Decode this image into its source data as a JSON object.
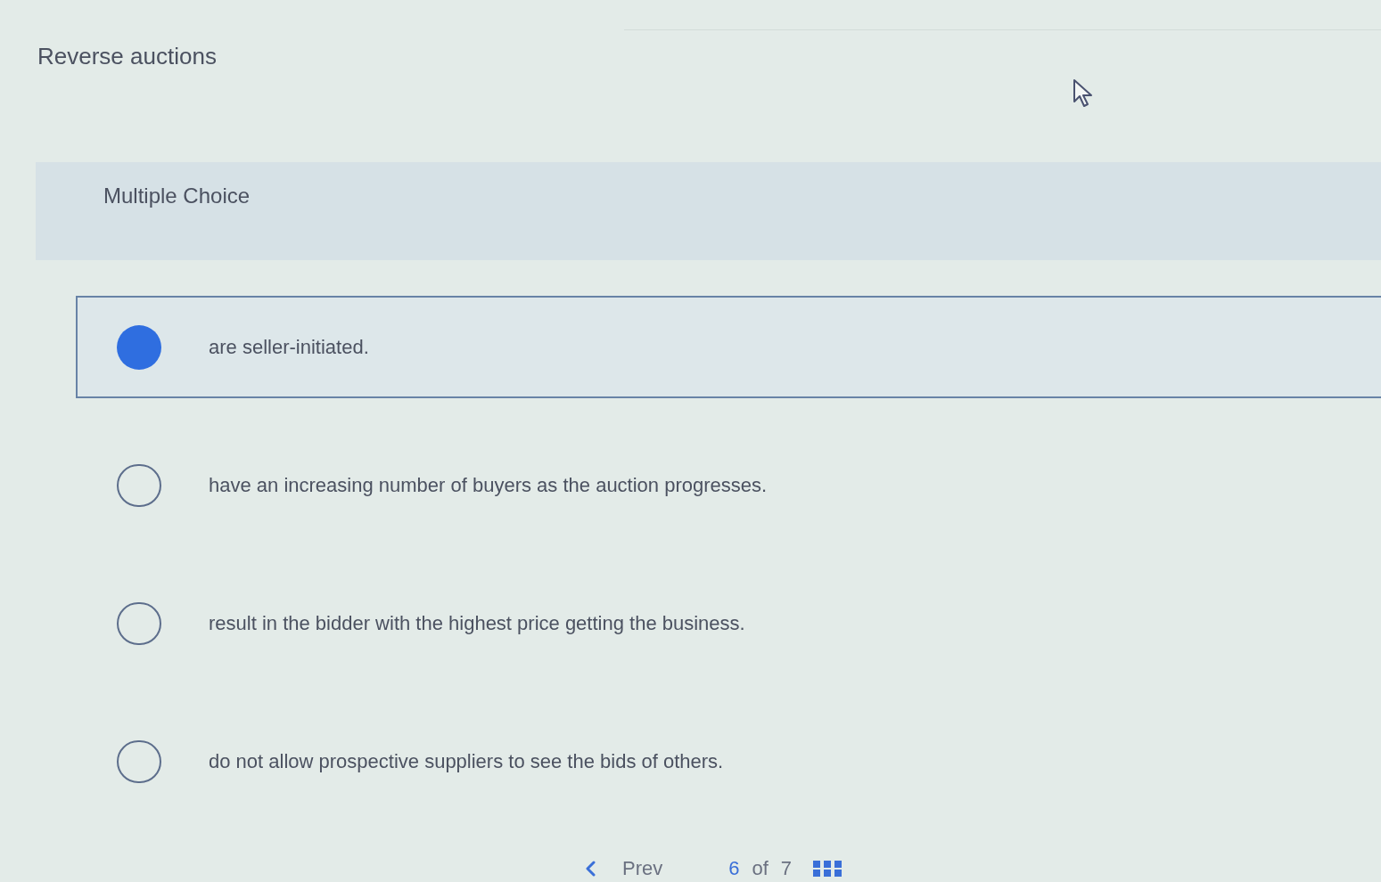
{
  "question": {
    "title": "Reverse auctions",
    "type_label": "Multiple Choice"
  },
  "options": [
    {
      "text": "are seller-initiated.",
      "selected": true
    },
    {
      "text": "have an increasing number of buyers as the auction progresses.",
      "selected": false
    },
    {
      "text": "result in the bidder with the highest price getting the business.",
      "selected": false
    },
    {
      "text": "do not allow prospective suppliers to see the bids of others.",
      "selected": false
    }
  ],
  "pager": {
    "prev": "Prev",
    "current": "6",
    "of": "of",
    "total": "7"
  }
}
